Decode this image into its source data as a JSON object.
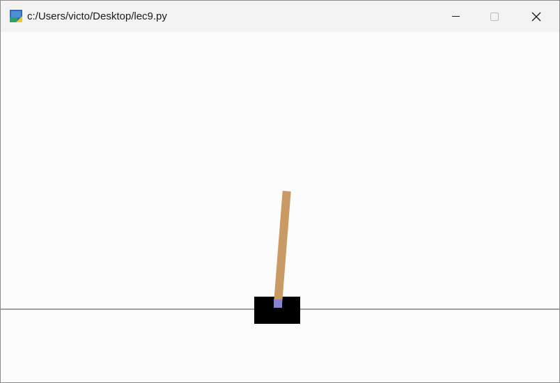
{
  "window": {
    "title": "c:/Users/victo/Desktop/lec9.py",
    "icon": "python-icon",
    "controls": [
      "minimize-icon",
      "maximize-icon",
      "close-icon"
    ]
  },
  "scene": {
    "environment": "CartPole",
    "pole_angle_deg_from_vertical": 4.5,
    "colors": {
      "background": "#fcfcfc",
      "track": "#6a6a6a",
      "cart": "#000000",
      "pole": "#c99a63",
      "axle": "#8585cf"
    }
  }
}
